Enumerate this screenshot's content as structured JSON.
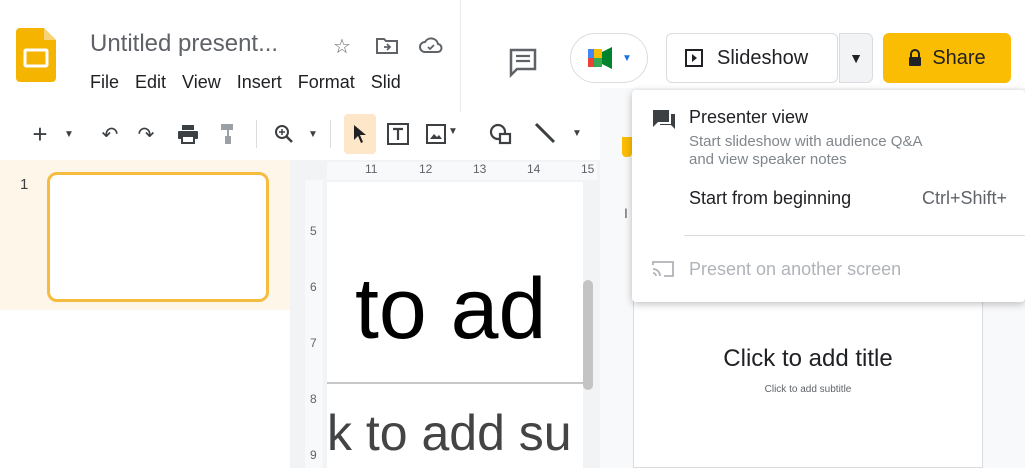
{
  "app": {
    "doc_title": "Untitled present...",
    "menu": [
      "File",
      "Edit",
      "View",
      "Insert",
      "Format",
      "Slid"
    ]
  },
  "icons": {
    "star": "☆",
    "undo": "↶",
    "redo": "↷",
    "print": "printer-icon",
    "zoom": "⌕"
  },
  "slides": {
    "number": "1"
  },
  "rulers": {
    "top": [
      "11",
      "12",
      "13",
      "14",
      "15"
    ],
    "left": [
      "5",
      "6",
      "7",
      "8",
      "9"
    ]
  },
  "canvas": {
    "title_text": "to ad",
    "subtitle_text": "k to add su"
  },
  "header": {
    "slideshow_label": "Slideshow",
    "share_label": "Share"
  },
  "side": {
    "tab_label": "I"
  },
  "dropdown": {
    "presenter_view": "Presenter view",
    "presenter_desc_1": "Start slideshow with audience Q&A",
    "presenter_desc_2": "and view speaker notes",
    "start_beginning": "Start from beginning",
    "start_shortcut": "Ctrl+Shift+",
    "present_other": "Present on another screen"
  },
  "preview": {
    "title": "Click to add title",
    "subtitle": "Click to add subtitle"
  },
  "colors": {
    "accent": "#fbbc04",
    "thumb_border": "#f5bc3f",
    "slides_panel": "#fef7e9"
  }
}
